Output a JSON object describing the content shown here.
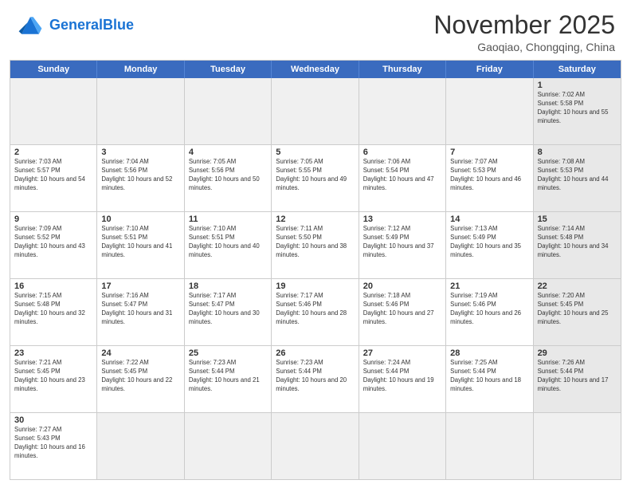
{
  "header": {
    "logo_general": "General",
    "logo_blue": "Blue",
    "month_title": "November 2025",
    "location": "Gaoqiao, Chongqing, China"
  },
  "days_of_week": [
    "Sunday",
    "Monday",
    "Tuesday",
    "Wednesday",
    "Thursday",
    "Friday",
    "Saturday"
  ],
  "weeks": [
    [
      {
        "day": "",
        "info": "",
        "empty": true
      },
      {
        "day": "",
        "info": "",
        "empty": true
      },
      {
        "day": "",
        "info": "",
        "empty": true
      },
      {
        "day": "",
        "info": "",
        "empty": true
      },
      {
        "day": "",
        "info": "",
        "empty": true
      },
      {
        "day": "",
        "info": "",
        "empty": true
      },
      {
        "day": "1",
        "info": "Sunrise: 7:02 AM\nSunset: 5:58 PM\nDaylight: 10 hours and 55 minutes.",
        "shaded": true
      }
    ],
    [
      {
        "day": "2",
        "info": "Sunrise: 7:03 AM\nSunset: 5:57 PM\nDaylight: 10 hours and 54 minutes."
      },
      {
        "day": "3",
        "info": "Sunrise: 7:04 AM\nSunset: 5:56 PM\nDaylight: 10 hours and 52 minutes."
      },
      {
        "day": "4",
        "info": "Sunrise: 7:05 AM\nSunset: 5:56 PM\nDaylight: 10 hours and 50 minutes."
      },
      {
        "day": "5",
        "info": "Sunrise: 7:05 AM\nSunset: 5:55 PM\nDaylight: 10 hours and 49 minutes."
      },
      {
        "day": "6",
        "info": "Sunrise: 7:06 AM\nSunset: 5:54 PM\nDaylight: 10 hours and 47 minutes."
      },
      {
        "day": "7",
        "info": "Sunrise: 7:07 AM\nSunset: 5:53 PM\nDaylight: 10 hours and 46 minutes."
      },
      {
        "day": "8",
        "info": "Sunrise: 7:08 AM\nSunset: 5:53 PM\nDaylight: 10 hours and 44 minutes.",
        "shaded": true
      }
    ],
    [
      {
        "day": "9",
        "info": "Sunrise: 7:09 AM\nSunset: 5:52 PM\nDaylight: 10 hours and 43 minutes."
      },
      {
        "day": "10",
        "info": "Sunrise: 7:10 AM\nSunset: 5:51 PM\nDaylight: 10 hours and 41 minutes."
      },
      {
        "day": "11",
        "info": "Sunrise: 7:10 AM\nSunset: 5:51 PM\nDaylight: 10 hours and 40 minutes."
      },
      {
        "day": "12",
        "info": "Sunrise: 7:11 AM\nSunset: 5:50 PM\nDaylight: 10 hours and 38 minutes."
      },
      {
        "day": "13",
        "info": "Sunrise: 7:12 AM\nSunset: 5:49 PM\nDaylight: 10 hours and 37 minutes."
      },
      {
        "day": "14",
        "info": "Sunrise: 7:13 AM\nSunset: 5:49 PM\nDaylight: 10 hours and 35 minutes."
      },
      {
        "day": "15",
        "info": "Sunrise: 7:14 AM\nSunset: 5:48 PM\nDaylight: 10 hours and 34 minutes.",
        "shaded": true
      }
    ],
    [
      {
        "day": "16",
        "info": "Sunrise: 7:15 AM\nSunset: 5:48 PM\nDaylight: 10 hours and 32 minutes."
      },
      {
        "day": "17",
        "info": "Sunrise: 7:16 AM\nSunset: 5:47 PM\nDaylight: 10 hours and 31 minutes."
      },
      {
        "day": "18",
        "info": "Sunrise: 7:17 AM\nSunset: 5:47 PM\nDaylight: 10 hours and 30 minutes."
      },
      {
        "day": "19",
        "info": "Sunrise: 7:17 AM\nSunset: 5:46 PM\nDaylight: 10 hours and 28 minutes."
      },
      {
        "day": "20",
        "info": "Sunrise: 7:18 AM\nSunset: 5:46 PM\nDaylight: 10 hours and 27 minutes."
      },
      {
        "day": "21",
        "info": "Sunrise: 7:19 AM\nSunset: 5:46 PM\nDaylight: 10 hours and 26 minutes."
      },
      {
        "day": "22",
        "info": "Sunrise: 7:20 AM\nSunset: 5:45 PM\nDaylight: 10 hours and 25 minutes.",
        "shaded": true
      }
    ],
    [
      {
        "day": "23",
        "info": "Sunrise: 7:21 AM\nSunset: 5:45 PM\nDaylight: 10 hours and 23 minutes."
      },
      {
        "day": "24",
        "info": "Sunrise: 7:22 AM\nSunset: 5:45 PM\nDaylight: 10 hours and 22 minutes."
      },
      {
        "day": "25",
        "info": "Sunrise: 7:23 AM\nSunset: 5:44 PM\nDaylight: 10 hours and 21 minutes."
      },
      {
        "day": "26",
        "info": "Sunrise: 7:23 AM\nSunset: 5:44 PM\nDaylight: 10 hours and 20 minutes."
      },
      {
        "day": "27",
        "info": "Sunrise: 7:24 AM\nSunset: 5:44 PM\nDaylight: 10 hours and 19 minutes."
      },
      {
        "day": "28",
        "info": "Sunrise: 7:25 AM\nSunset: 5:44 PM\nDaylight: 10 hours and 18 minutes."
      },
      {
        "day": "29",
        "info": "Sunrise: 7:26 AM\nSunset: 5:44 PM\nDaylight: 10 hours and 17 minutes.",
        "shaded": true
      }
    ],
    [
      {
        "day": "30",
        "info": "Sunrise: 7:27 AM\nSunset: 5:43 PM\nDaylight: 10 hours and 16 minutes."
      },
      {
        "day": "",
        "info": "",
        "empty": true
      },
      {
        "day": "",
        "info": "",
        "empty": true
      },
      {
        "day": "",
        "info": "",
        "empty": true
      },
      {
        "day": "",
        "info": "",
        "empty": true
      },
      {
        "day": "",
        "info": "",
        "empty": true
      },
      {
        "day": "",
        "info": "",
        "empty": true,
        "shaded": true
      }
    ]
  ]
}
